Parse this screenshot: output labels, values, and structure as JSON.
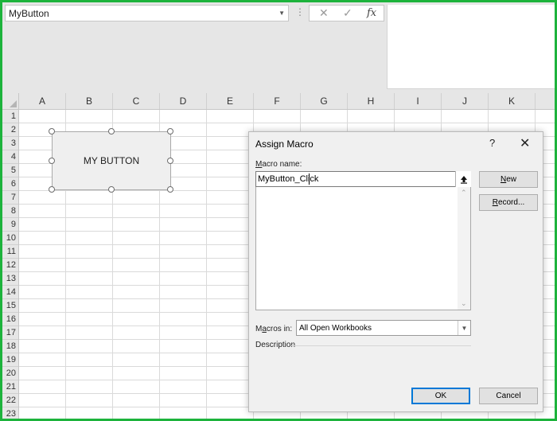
{
  "namebox": {
    "value": "MyButton"
  },
  "formula_buttons": {
    "cancel_glyph": "✕",
    "enter_glyph": "✓",
    "fx_label": "fx"
  },
  "columns": [
    "A",
    "B",
    "C",
    "D",
    "E",
    "F",
    "G",
    "H",
    "I",
    "J",
    "K"
  ],
  "rows": [
    "1",
    "2",
    "3",
    "4",
    "5",
    "6",
    "7",
    "8",
    "9",
    "10",
    "11",
    "12",
    "13",
    "14",
    "15",
    "16",
    "17",
    "18",
    "19",
    "20",
    "21",
    "22",
    "23"
  ],
  "shape": {
    "label": "MY BUTTON"
  },
  "dialog": {
    "title": "Assign Macro",
    "help_glyph": "?",
    "close_glyph": "✕",
    "macro_name_label_pre": "M",
    "macro_name_label_post": "acro name:",
    "macro_name_value": "MyButton_Click",
    "new_button_pre": "N",
    "new_button_post": "ew",
    "record_button_pre": "R",
    "record_button_post": "ecord...",
    "macros_in_label_pre": "M",
    "macros_in_label_mid": "a",
    "macros_in_label_post": "cros in:",
    "macros_in_value": "All Open Workbooks",
    "description_label": "Description",
    "ok_label": "OK",
    "cancel_label": "Cancel"
  }
}
